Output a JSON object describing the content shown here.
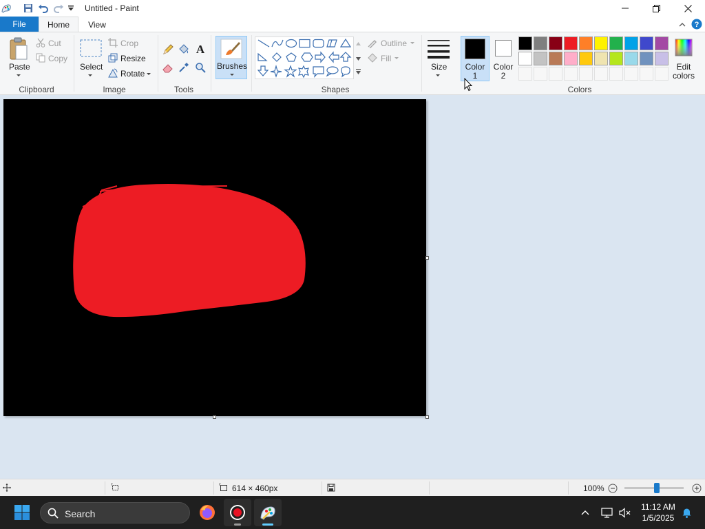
{
  "window": {
    "title": "Untitled - Paint"
  },
  "tabs": {
    "file": "File",
    "home": "Home",
    "view": "View"
  },
  "clipboard": {
    "paste": "Paste",
    "cut": "Cut",
    "copy": "Copy",
    "group": "Clipboard"
  },
  "image": {
    "select": "Select",
    "crop": "Crop",
    "resize": "Resize",
    "rotate": "Rotate",
    "group": "Image"
  },
  "tools": {
    "group": "Tools"
  },
  "brushes": {
    "label": "Brushes"
  },
  "shapes": {
    "outline": "Outline",
    "fill": "Fill",
    "group": "Shapes"
  },
  "size": {
    "label": "Size"
  },
  "colors": {
    "color1_line1": "Color",
    "color1_line2": "1",
    "color2_line1": "Color",
    "color2_line2": "2",
    "edit_line1": "Edit",
    "edit_line2": "colors",
    "group": "Colors",
    "color1_value": "#000000",
    "color2_value": "#ffffff",
    "palette_row1": [
      "#000000",
      "#7f7f7f",
      "#880015",
      "#ed1c24",
      "#ff7f27",
      "#fff200",
      "#22b14c",
      "#00a2e8",
      "#3f48cc",
      "#a349a4"
    ],
    "palette_row2": [
      "#ffffff",
      "#c3c3c3",
      "#b97a57",
      "#ffaec9",
      "#ffc90e",
      "#efe4b0",
      "#b5e61d",
      "#99d9ea",
      "#7092be",
      "#c8bfe7"
    ]
  },
  "canvas": {
    "background": "#000000",
    "blob_color": "#ed1c24"
  },
  "status": {
    "dimensions": "614 × 460px",
    "zoom": "100%",
    "zoom_percent": 100
  },
  "taskbar": {
    "search_label": "Search",
    "time": "11:12 AM",
    "date": "1/5/2025"
  }
}
